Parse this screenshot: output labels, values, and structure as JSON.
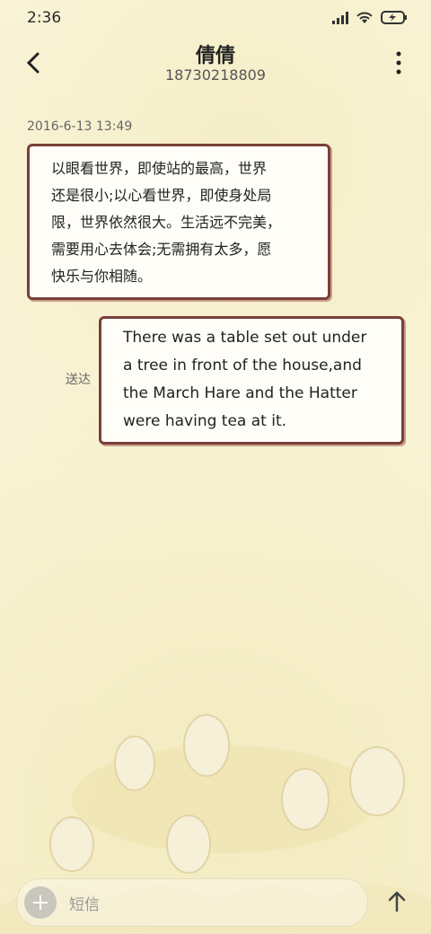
{
  "status_bar": {
    "time": "2:36",
    "icons": [
      "signal-icon",
      "wifi-icon",
      "battery-charging-icon"
    ]
  },
  "header": {
    "contact_name": "倩倩",
    "contact_number": "18730218809",
    "icons": [
      "back-icon",
      "more-icon"
    ]
  },
  "messages": [
    {
      "direction": "incoming",
      "timestamp": "2016-6-13 13:49",
      "text": "以眼看世界，即使站的最高，世界\n还是很小;以心看世界，即使身处局\n限，世界依然很大。生活远不完美，\n需要用心去体会;无需拥有太多，愿\n快乐与你相随。"
    },
    {
      "direction": "outgoing",
      "status": "送达",
      "text": "There was a table set out under\na tree in front of the house,and\nthe March Hare and the Hatter\nwere having tea at it."
    }
  ],
  "composer": {
    "placeholder": "短信",
    "icons": [
      "add-icon",
      "send-arrow-icon"
    ]
  },
  "colors": {
    "bubble_border": "#7a3f3a",
    "background": "#fbf6da"
  }
}
